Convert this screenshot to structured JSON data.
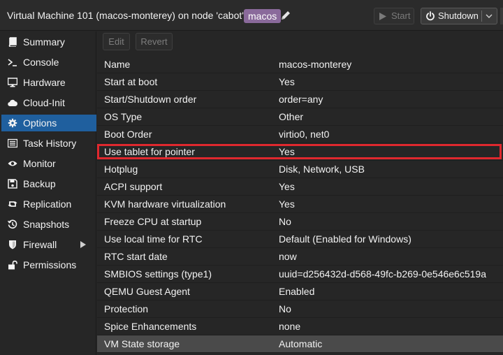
{
  "header": {
    "title": "Virtual Machine 101 (macos-monterey) on node 'cabot'",
    "tag": "macos",
    "start_label": "Start",
    "shutdown_label": "Shutdown"
  },
  "toolbar": {
    "edit_label": "Edit",
    "revert_label": "Revert"
  },
  "sidebar": {
    "items": [
      {
        "label": "Summary",
        "icon": "book-icon"
      },
      {
        "label": "Console",
        "icon": "terminal-icon"
      },
      {
        "label": "Hardware",
        "icon": "desktop-icon"
      },
      {
        "label": "Cloud-Init",
        "icon": "cloud-icon"
      },
      {
        "label": "Options",
        "icon": "gear-icon",
        "active": true
      },
      {
        "label": "Task History",
        "icon": "list-icon"
      },
      {
        "label": "Monitor",
        "icon": "eye-icon"
      },
      {
        "label": "Backup",
        "icon": "floppy-icon"
      },
      {
        "label": "Replication",
        "icon": "retweet-icon"
      },
      {
        "label": "Snapshots",
        "icon": "history-icon"
      },
      {
        "label": "Firewall",
        "icon": "shield-icon"
      },
      {
        "label": "Permissions",
        "icon": "unlock-icon"
      }
    ]
  },
  "options": [
    {
      "key": "Name",
      "value": "macos-monterey"
    },
    {
      "key": "Start at boot",
      "value": "Yes"
    },
    {
      "key": "Start/Shutdown order",
      "value": "order=any"
    },
    {
      "key": "OS Type",
      "value": "Other"
    },
    {
      "key": "Boot Order",
      "value": "virtio0, net0"
    },
    {
      "key": "Use tablet for pointer",
      "value": "Yes"
    },
    {
      "key": "Hotplug",
      "value": "Disk, Network, USB"
    },
    {
      "key": "ACPI support",
      "value": "Yes"
    },
    {
      "key": "KVM hardware virtualization",
      "value": "Yes"
    },
    {
      "key": "Freeze CPU at startup",
      "value": "No"
    },
    {
      "key": "Use local time for RTC",
      "value": "Default (Enabled for Windows)"
    },
    {
      "key": "RTC start date",
      "value": "now"
    },
    {
      "key": "SMBIOS settings (type1)",
      "value": "uuid=d256432d-d568-49fc-b269-0e546e6c519a"
    },
    {
      "key": "QEMU Guest Agent",
      "value": "Enabled"
    },
    {
      "key": "Protection",
      "value": "No"
    },
    {
      "key": "Spice Enhancements",
      "value": "none"
    },
    {
      "key": "VM State storage",
      "value": "Automatic"
    }
  ],
  "colors": {
    "accent": "#1f5f9e",
    "tag": "#8a6a9b",
    "highlight": "#e0282e"
  }
}
